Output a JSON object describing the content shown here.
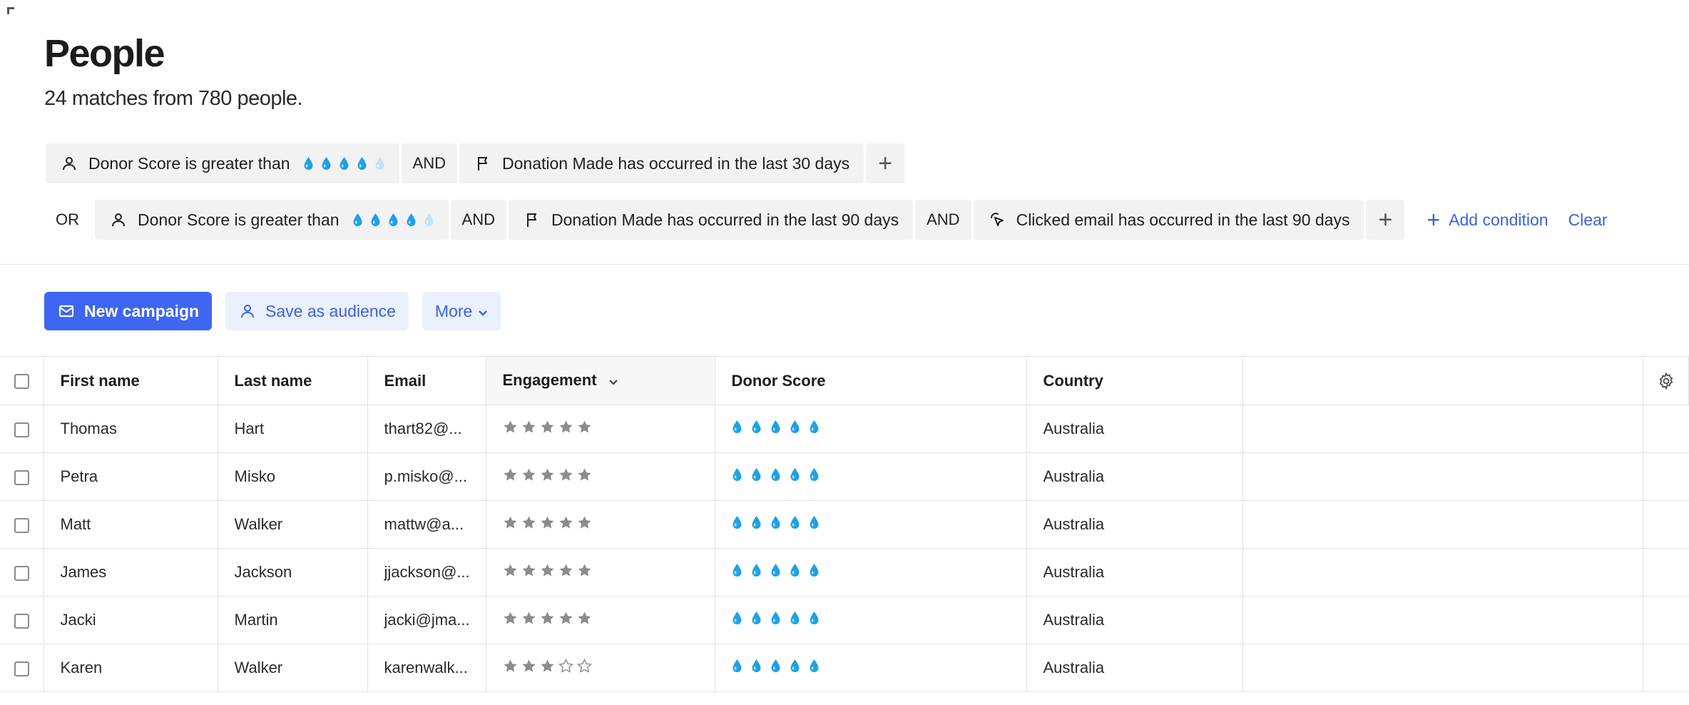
{
  "header": {
    "title": "People",
    "subtitle": "24 matches from 780 people."
  },
  "filters": {
    "group1": {
      "cond1_label": "Donor Score is greater than",
      "cond1_score": 4,
      "join1": "AND",
      "cond2_label": "Donation Made has occurred in the last 30 days",
      "add_label": "+"
    },
    "or_label": "OR",
    "group2": {
      "cond1_label": "Donor Score is greater than",
      "cond1_score": 4,
      "join1": "AND",
      "cond2_label": "Donation Made has occurred in the last 90 days",
      "join2": "AND",
      "cond3_label": "Clicked email has occurred in the last 90 days",
      "add_label": "+"
    },
    "add_condition_label": "Add condition",
    "clear_label": "Clear"
  },
  "actions": {
    "new_campaign": "New campaign",
    "save_audience": "Save as audience",
    "more": "More"
  },
  "table": {
    "columns": {
      "first_name": "First name",
      "last_name": "Last name",
      "email": "Email",
      "engagement": "Engagement",
      "donor_score": "Donor Score",
      "country": "Country"
    },
    "rows": [
      {
        "first": "Thomas",
        "last": "Hart",
        "email": "thart82@...",
        "engagement": 5,
        "donor_score": 5,
        "country": "Australia"
      },
      {
        "first": "Petra",
        "last": "Misko",
        "email": "p.misko@...",
        "engagement": 5,
        "donor_score": 5,
        "country": "Australia"
      },
      {
        "first": "Matt",
        "last": "Walker",
        "email": "mattw@a...",
        "engagement": 5,
        "donor_score": 5,
        "country": "Australia"
      },
      {
        "first": "James",
        "last": "Jackson",
        "email": "jjackson@...",
        "engagement": 5,
        "donor_score": 5,
        "country": "Australia"
      },
      {
        "first": "Jacki",
        "last": "Martin",
        "email": "jacki@jma...",
        "engagement": 5,
        "donor_score": 5,
        "country": "Australia"
      },
      {
        "first": "Karen",
        "last": "Walker",
        "email": "karenwalk...",
        "engagement": 3,
        "donor_score": 5,
        "country": "Australia"
      }
    ]
  },
  "colors": {
    "accent": "#3f66f0",
    "link": "#3a62e0",
    "drop_filled": "#1ea1e6",
    "drop_empty": "#bfe3f7",
    "star_filled": "#8c8c8c"
  }
}
